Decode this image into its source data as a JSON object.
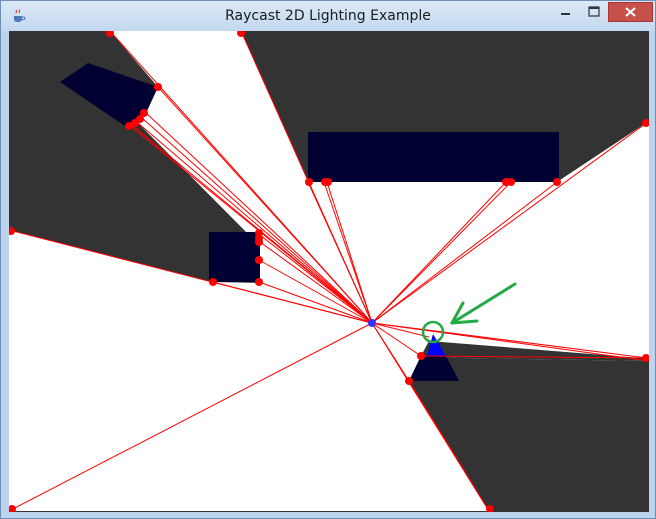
{
  "window": {
    "title": "Raycast 2D Lighting Example"
  },
  "icons": {
    "app": "java-cup-icon",
    "minimize": "minimize-icon",
    "maximize": "maximize-icon",
    "close": "close-icon",
    "annotation_arrow": "green-arrow-icon",
    "annotation_circle": "green-circle-marker"
  },
  "colors": {
    "shadow": "#333333",
    "lit": "#ffffff",
    "obstacle": "#000033",
    "ray": "#ff0000",
    "hit_point": "#ff0000",
    "light_source": "#3333ff",
    "player_triangle": "#0000ff",
    "annotation": "#22aa44"
  }
}
